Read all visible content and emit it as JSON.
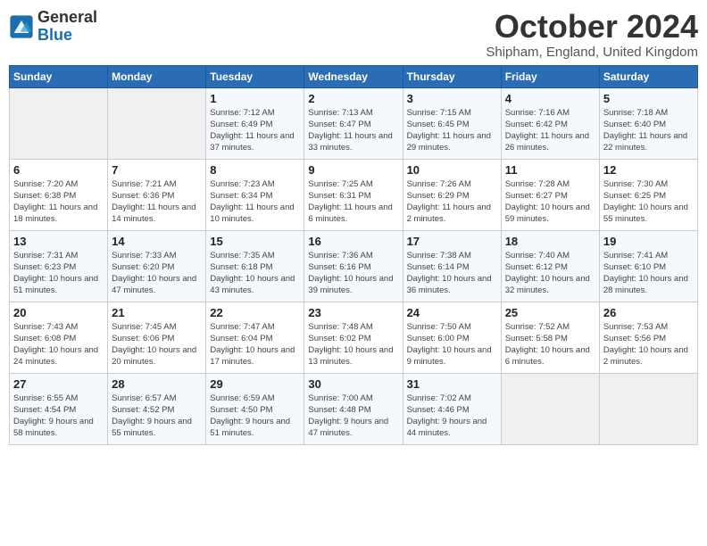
{
  "logo": {
    "general": "General",
    "blue": "Blue"
  },
  "title": "October 2024",
  "location": "Shipham, England, United Kingdom",
  "days_of_week": [
    "Sunday",
    "Monday",
    "Tuesday",
    "Wednesday",
    "Thursday",
    "Friday",
    "Saturday"
  ],
  "weeks": [
    [
      {
        "day": "",
        "info": ""
      },
      {
        "day": "",
        "info": ""
      },
      {
        "day": "1",
        "info": "Sunrise: 7:12 AM\nSunset: 6:49 PM\nDaylight: 11 hours and 37 minutes."
      },
      {
        "day": "2",
        "info": "Sunrise: 7:13 AM\nSunset: 6:47 PM\nDaylight: 11 hours and 33 minutes."
      },
      {
        "day": "3",
        "info": "Sunrise: 7:15 AM\nSunset: 6:45 PM\nDaylight: 11 hours and 29 minutes."
      },
      {
        "day": "4",
        "info": "Sunrise: 7:16 AM\nSunset: 6:42 PM\nDaylight: 11 hours and 26 minutes."
      },
      {
        "day": "5",
        "info": "Sunrise: 7:18 AM\nSunset: 6:40 PM\nDaylight: 11 hours and 22 minutes."
      }
    ],
    [
      {
        "day": "6",
        "info": "Sunrise: 7:20 AM\nSunset: 6:38 PM\nDaylight: 11 hours and 18 minutes."
      },
      {
        "day": "7",
        "info": "Sunrise: 7:21 AM\nSunset: 6:36 PM\nDaylight: 11 hours and 14 minutes."
      },
      {
        "day": "8",
        "info": "Sunrise: 7:23 AM\nSunset: 6:34 PM\nDaylight: 11 hours and 10 minutes."
      },
      {
        "day": "9",
        "info": "Sunrise: 7:25 AM\nSunset: 6:31 PM\nDaylight: 11 hours and 6 minutes."
      },
      {
        "day": "10",
        "info": "Sunrise: 7:26 AM\nSunset: 6:29 PM\nDaylight: 11 hours and 2 minutes."
      },
      {
        "day": "11",
        "info": "Sunrise: 7:28 AM\nSunset: 6:27 PM\nDaylight: 10 hours and 59 minutes."
      },
      {
        "day": "12",
        "info": "Sunrise: 7:30 AM\nSunset: 6:25 PM\nDaylight: 10 hours and 55 minutes."
      }
    ],
    [
      {
        "day": "13",
        "info": "Sunrise: 7:31 AM\nSunset: 6:23 PM\nDaylight: 10 hours and 51 minutes."
      },
      {
        "day": "14",
        "info": "Sunrise: 7:33 AM\nSunset: 6:20 PM\nDaylight: 10 hours and 47 minutes."
      },
      {
        "day": "15",
        "info": "Sunrise: 7:35 AM\nSunset: 6:18 PM\nDaylight: 10 hours and 43 minutes."
      },
      {
        "day": "16",
        "info": "Sunrise: 7:36 AM\nSunset: 6:16 PM\nDaylight: 10 hours and 39 minutes."
      },
      {
        "day": "17",
        "info": "Sunrise: 7:38 AM\nSunset: 6:14 PM\nDaylight: 10 hours and 36 minutes."
      },
      {
        "day": "18",
        "info": "Sunrise: 7:40 AM\nSunset: 6:12 PM\nDaylight: 10 hours and 32 minutes."
      },
      {
        "day": "19",
        "info": "Sunrise: 7:41 AM\nSunset: 6:10 PM\nDaylight: 10 hours and 28 minutes."
      }
    ],
    [
      {
        "day": "20",
        "info": "Sunrise: 7:43 AM\nSunset: 6:08 PM\nDaylight: 10 hours and 24 minutes."
      },
      {
        "day": "21",
        "info": "Sunrise: 7:45 AM\nSunset: 6:06 PM\nDaylight: 10 hours and 20 minutes."
      },
      {
        "day": "22",
        "info": "Sunrise: 7:47 AM\nSunset: 6:04 PM\nDaylight: 10 hours and 17 minutes."
      },
      {
        "day": "23",
        "info": "Sunrise: 7:48 AM\nSunset: 6:02 PM\nDaylight: 10 hours and 13 minutes."
      },
      {
        "day": "24",
        "info": "Sunrise: 7:50 AM\nSunset: 6:00 PM\nDaylight: 10 hours and 9 minutes."
      },
      {
        "day": "25",
        "info": "Sunrise: 7:52 AM\nSunset: 5:58 PM\nDaylight: 10 hours and 6 minutes."
      },
      {
        "day": "26",
        "info": "Sunrise: 7:53 AM\nSunset: 5:56 PM\nDaylight: 10 hours and 2 minutes."
      }
    ],
    [
      {
        "day": "27",
        "info": "Sunrise: 6:55 AM\nSunset: 4:54 PM\nDaylight: 9 hours and 58 minutes."
      },
      {
        "day": "28",
        "info": "Sunrise: 6:57 AM\nSunset: 4:52 PM\nDaylight: 9 hours and 55 minutes."
      },
      {
        "day": "29",
        "info": "Sunrise: 6:59 AM\nSunset: 4:50 PM\nDaylight: 9 hours and 51 minutes."
      },
      {
        "day": "30",
        "info": "Sunrise: 7:00 AM\nSunset: 4:48 PM\nDaylight: 9 hours and 47 minutes."
      },
      {
        "day": "31",
        "info": "Sunrise: 7:02 AM\nSunset: 4:46 PM\nDaylight: 9 hours and 44 minutes."
      },
      {
        "day": "",
        "info": ""
      },
      {
        "day": "",
        "info": ""
      }
    ]
  ]
}
